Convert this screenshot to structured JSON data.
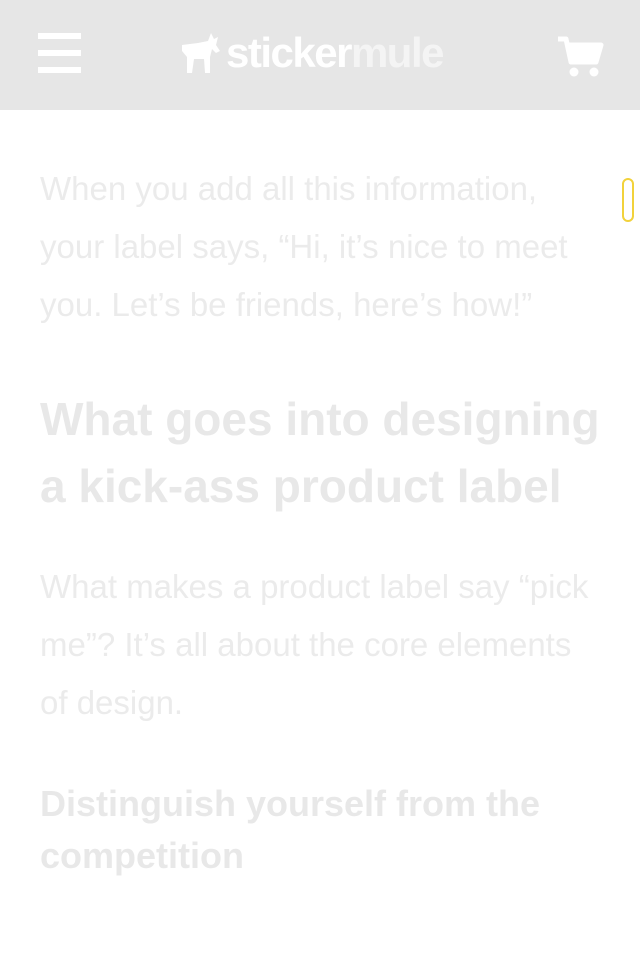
{
  "header": {
    "menu_icon": "hamburger-menu-icon",
    "logo": {
      "part1": "sticker",
      "part2": "mule",
      "icon": "mule-icon"
    },
    "cart_icon": "shopping-cart-icon"
  },
  "article": {
    "intro": "When you add all this information, your label says, “Hi, it’s nice to meet you. Let’s be friends, here’s how!”",
    "heading": "What goes into designing a kick-ass product label",
    "body": "What makes a product label say “pick me”? It’s all about the core elements of design.",
    "subheading": "Distinguish yourself from the competition"
  },
  "colors": {
    "header_bg": "#e6e6e6",
    "text_faded": "#ebebeb",
    "scroll_indicator": "#f2d23b"
  }
}
